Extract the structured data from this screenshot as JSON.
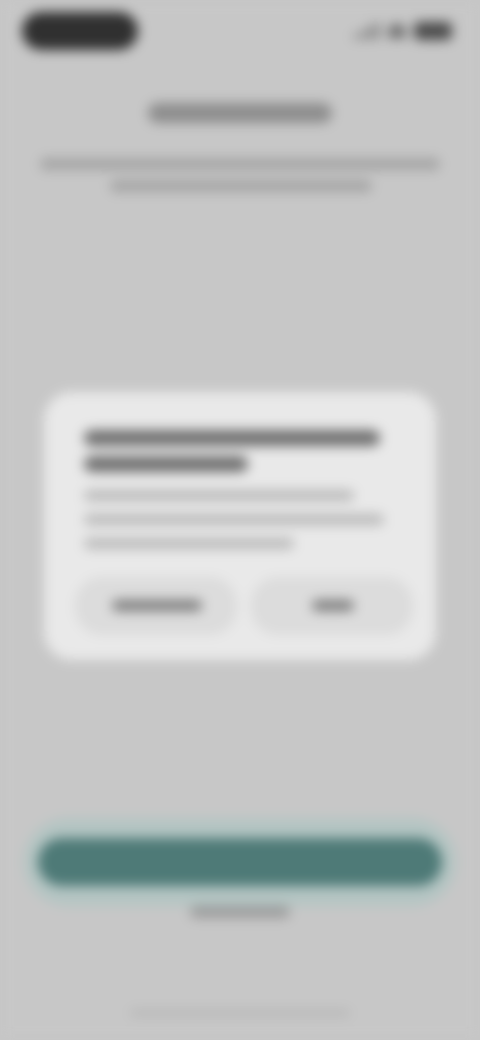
{
  "colors": {
    "background": "#c7c7c7",
    "dialog": "#e9e9e9",
    "primary_button": "#4e7a77",
    "status_pill": "#303030"
  },
  "icons": {
    "signal": "signal-icon",
    "wifi": "wifi-icon",
    "battery": "battery-icon"
  }
}
